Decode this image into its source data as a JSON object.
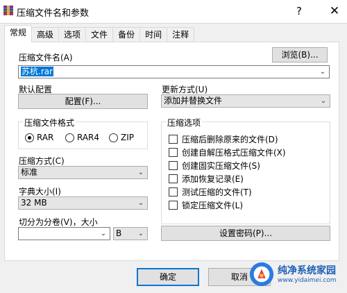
{
  "window": {
    "title": "压缩文件名和参数",
    "help_label": "?",
    "close_label": "✕"
  },
  "tabs": [
    {
      "label": "常规",
      "active": true
    },
    {
      "label": "高级",
      "active": false
    },
    {
      "label": "选项",
      "active": false
    },
    {
      "label": "文件",
      "active": false
    },
    {
      "label": "备份",
      "active": false
    },
    {
      "label": "时间",
      "active": false
    },
    {
      "label": "注释",
      "active": false
    }
  ],
  "general": {
    "archive_name_label": "压缩文件名(A)",
    "browse_label": "浏览(B)...",
    "archive_name_value": "苏杭.rar",
    "default_profile_label": "默认配置",
    "profiles_button": "配置(F)...",
    "update_mode_label": "更新方式(U)",
    "update_mode_value": "添加并替换文件",
    "format_group_label": "压缩文件格式",
    "formats": [
      {
        "label": "RAR",
        "checked": true
      },
      {
        "label": "RAR4",
        "checked": false
      },
      {
        "label": "ZIP",
        "checked": false
      }
    ],
    "method_label": "压缩方式(C)",
    "method_value": "标准",
    "dict_label": "字典大小(I)",
    "dict_value": "32 MB",
    "split_label": "切分为分卷(V)，大小",
    "split_value": "",
    "split_unit": "B",
    "options_group_label": "压缩选项",
    "options": [
      {
        "label": "压缩后删除原来的文件(D)",
        "checked": false
      },
      {
        "label": "创建自解压格式压缩文件(X)",
        "checked": false
      },
      {
        "label": "创建固实压缩文件(S)",
        "checked": false
      },
      {
        "label": "添加恢复记录(E)",
        "checked": false
      },
      {
        "label": "测试压缩的文件(T)",
        "checked": false
      },
      {
        "label": "锁定压缩文件(L)",
        "checked": false
      }
    ],
    "password_button": "设置密码(P)..."
  },
  "footer": {
    "ok_label": "确定",
    "cancel_label": "取消"
  },
  "watermark": {
    "title": "纯净系统家园",
    "url": "www.yidaimei.com"
  },
  "colors": {
    "selection": "#0078d7",
    "default_button_border": "#0078d7",
    "watermark_blue": "#1d5fb5"
  }
}
